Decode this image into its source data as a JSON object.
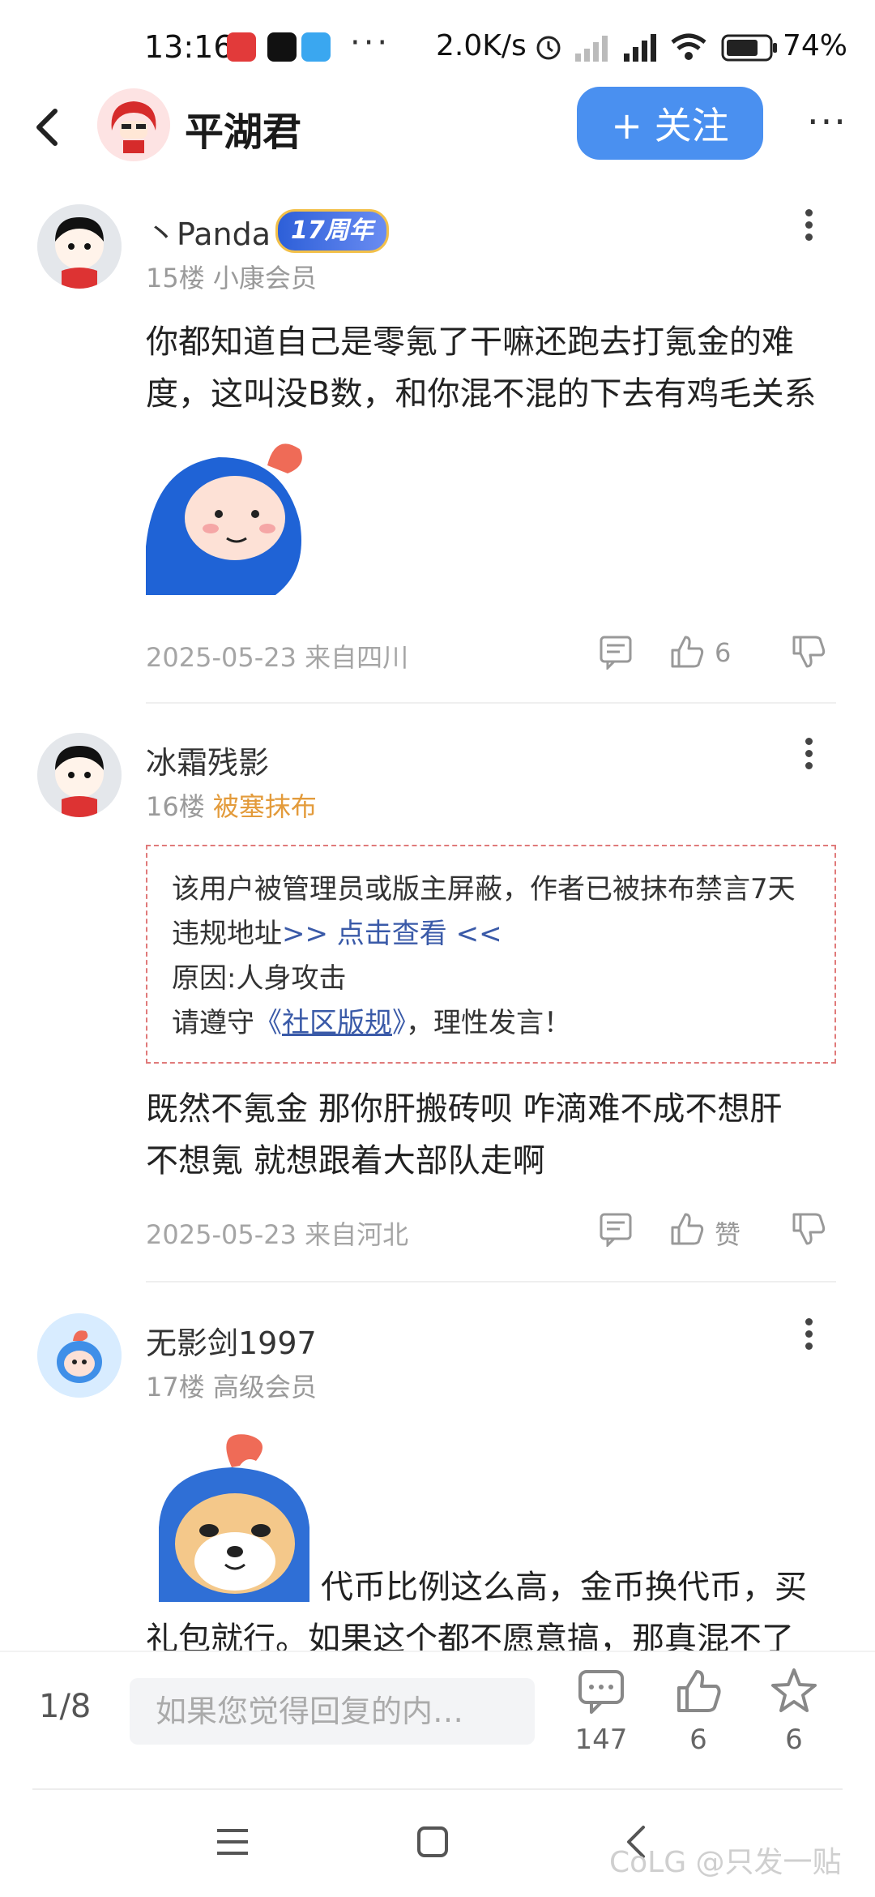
{
  "status": {
    "time": "13:16",
    "dots": "···",
    "speed": "2.0K/s",
    "battery": "74%"
  },
  "header": {
    "title": "平湖君",
    "follow_label": "+ 关注"
  },
  "posts": [
    {
      "username": "丶Panda",
      "badge": "17周年",
      "floor": "15楼",
      "level": "小康会员",
      "text": "你都知道自己是零氪了干嘛还跑去打氪金的难度，这叫没B数，和你混不混的下去有鸡毛关系",
      "date_loc": "2025-05-23 来自四川",
      "likes": "6"
    },
    {
      "username": "冰霜残影",
      "floor": "16楼",
      "level": "被塞抹布",
      "notice": {
        "line1": "该用户被管理员或版主屏蔽，作者已被抹布禁言7天",
        "line2_prefix": "违规地址",
        "line2_link": ">> 点击查看 <<",
        "line3": "原因:人身攻击",
        "line4_prefix": "请遵守",
        "line4_link_open": "《",
        "line4_link": "社区版规",
        "line4_link_close": "》",
        "line4_suffix": "，理性发言！"
      },
      "text": "既然不氪金  那你肝搬砖呗   咋滴难不成不想肝  不想氪  就想跟着大部队走啊",
      "date_loc": "2025-05-23 来自河北",
      "likes": "赞"
    },
    {
      "username": "无影剑1997",
      "floor": "17楼",
      "level": "高级会员",
      "text_line1": "代币比例这么高，金币换代币，买",
      "text_line2": "礼包就行。如果这个都不愿意搞，那真混不了"
    }
  ],
  "bottom": {
    "page": "1/8",
    "input_placeholder": "如果您觉得回复的内…",
    "comments": "147",
    "likes": "6",
    "favorites": "6"
  },
  "watermark": "CoLG @只发一贴",
  "colors": {
    "accent": "#4a90f0",
    "level_tag": "#e39b3b",
    "notice_border": "#e07a7a",
    "link": "#3a5aa8"
  }
}
